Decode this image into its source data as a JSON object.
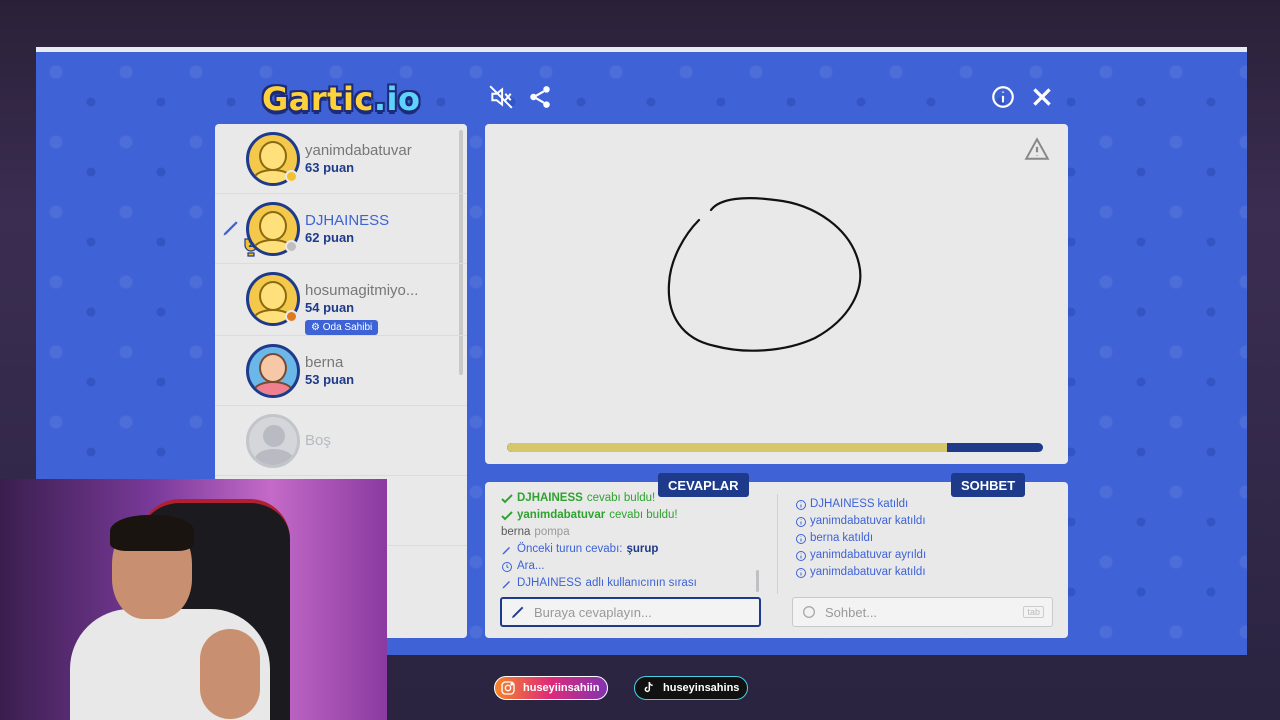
{
  "logo": {
    "text_main": "Gartic",
    "text_suffix": ".io"
  },
  "header": {
    "icons": [
      "mute-icon",
      "share-icon",
      "info-icon",
      "close-icon"
    ]
  },
  "players": [
    {
      "name": "yanimdabatuvar",
      "points": "63 puan",
      "badge_color": "#f2c12e"
    },
    {
      "name": "DJHAINESS",
      "points": "62 puan",
      "badge_color": "#bfbfbf",
      "drawing": true,
      "trophy": "2"
    },
    {
      "name": "hosumagitmiyo...",
      "points": "54 puan",
      "badge_color": "#e07820",
      "owner_label": "Oda Sahibi"
    },
    {
      "name": "berna",
      "points": "53 puan"
    }
  ],
  "empty_slot": {
    "label": "Boş"
  },
  "canvas": {
    "timer_fraction": 0.82
  },
  "tabs": {
    "answers": "CEVAPLAR",
    "chat": "SOHBET"
  },
  "answers_log": [
    {
      "type": "found",
      "user": "DJHAINESS",
      "text": "cevabı buldu!"
    },
    {
      "type": "found",
      "user": "yanimdabatuvar",
      "text": "cevabı buldu!"
    },
    {
      "type": "guess",
      "user": "berna",
      "text": "pompa"
    },
    {
      "type": "prev",
      "text": "Önceki turun cevabı:",
      "word": "şurup"
    },
    {
      "type": "wait",
      "text": "Ara..."
    },
    {
      "type": "turn",
      "user": "DJHAINESS",
      "text": "adlı kullanıcının sırası"
    }
  ],
  "chat_log": [
    {
      "user": "DJHAINESS",
      "text": "katıldı"
    },
    {
      "user": "yanimdabatuvar",
      "text": "katıldı"
    },
    {
      "user": "berna",
      "text": "katıldı"
    },
    {
      "user": "yanimdabatuvar",
      "text": "ayrıldı"
    },
    {
      "user": "yanimdabatuvar",
      "text": "katıldı"
    }
  ],
  "inputs": {
    "answer_placeholder": "Buraya cevaplayın...",
    "chat_placeholder": "Sohbet...",
    "chat_hint": "tab"
  },
  "socials": {
    "instagram": "huseyiinsahiin",
    "tiktok": "huseyinsahins"
  }
}
